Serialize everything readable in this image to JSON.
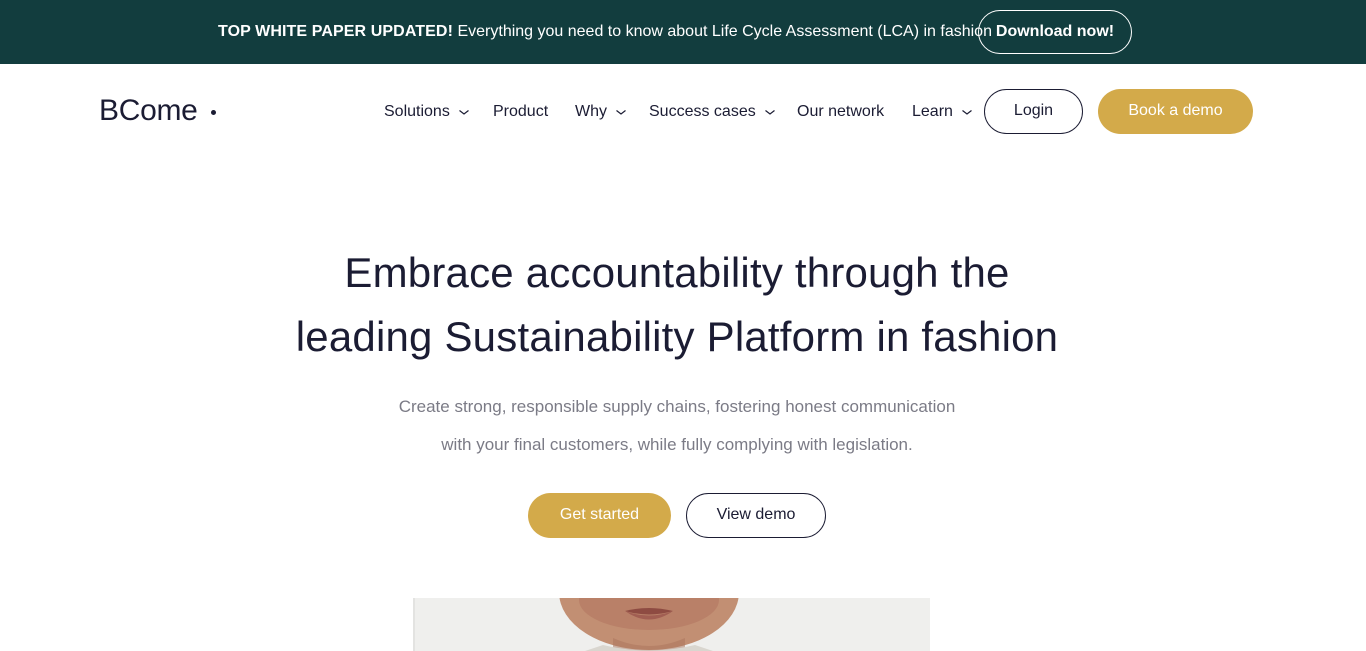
{
  "announcement": {
    "highlight": "TOP WHITE PAPER UPDATED!",
    "text": "Everything you need to know about Life Cycle Assessment (LCA) in fashion",
    "button_label": "Download now!"
  },
  "header": {
    "logo_text": "BCome",
    "nav": [
      {
        "label": "Solutions",
        "has_dropdown": true
      },
      {
        "label": "Product",
        "has_dropdown": false
      },
      {
        "label": "Why",
        "has_dropdown": true
      },
      {
        "label": "Success cases",
        "has_dropdown": true
      },
      {
        "label": "Our network",
        "has_dropdown": false
      },
      {
        "label": "Learn",
        "has_dropdown": true
      }
    ],
    "login_label": "Login",
    "demo_label": "Book a demo"
  },
  "hero": {
    "title_line1": "Embrace accountability through the",
    "title_line2": "leading Sustainability Platform in fashion",
    "subtitle_line1": "Create strong, responsible supply chains, fostering honest communication",
    "subtitle_line2": "with your final customers, while fully complying with legislation.",
    "primary_label": "Get started",
    "secondary_label": "View demo"
  },
  "colors": {
    "announcement_bg": "#123d3e",
    "accent_gold": "#d3aa4a",
    "text_dark": "#1b1c33",
    "text_muted": "#7b7b86"
  },
  "icons": {
    "dropdown": "chevron-down-icon"
  }
}
